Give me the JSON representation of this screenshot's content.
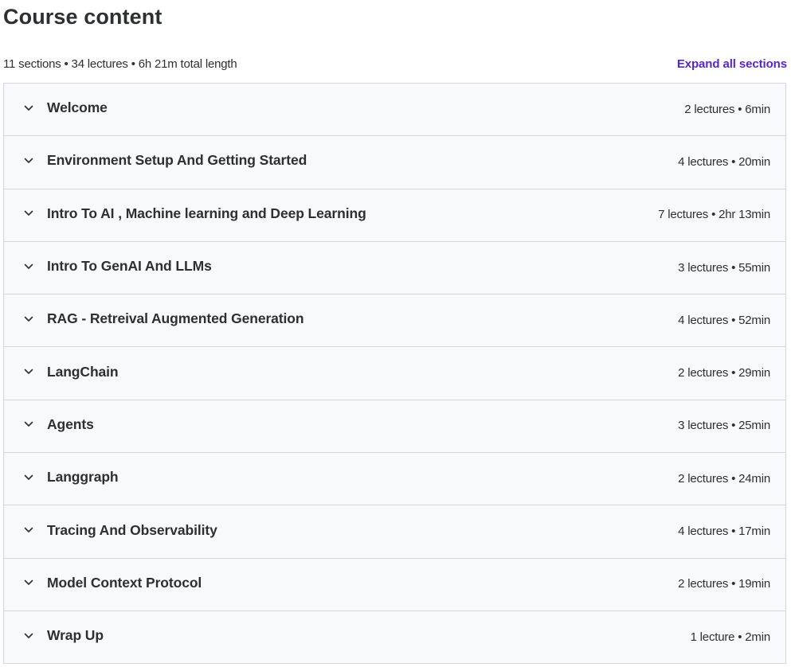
{
  "header": {
    "title": "Course content",
    "summary": "11 sections • 34 lectures • 6h 21m total length",
    "expand_all_label": "Expand all sections",
    "accent_color": "#5624d0"
  },
  "sections": [
    {
      "title": "Welcome",
      "meta": "2 lectures • 6min",
      "icon": "chevron-down-icon"
    },
    {
      "title": "Environment Setup And Getting Started",
      "meta": "4 lectures • 20min",
      "icon": "chevron-down-icon"
    },
    {
      "title": "Intro To AI , Machine learning and Deep Learning",
      "meta": "7 lectures • 2hr 13min",
      "icon": "chevron-down-icon"
    },
    {
      "title": "Intro To GenAI And LLMs",
      "meta": "3 lectures • 55min",
      "icon": "chevron-down-icon"
    },
    {
      "title": "RAG - Retreival Augmented Generation",
      "meta": "4 lectures • 52min",
      "icon": "chevron-down-icon"
    },
    {
      "title": "LangChain",
      "meta": "2 lectures • 29min",
      "icon": "chevron-down-icon"
    },
    {
      "title": "Agents",
      "meta": "3 lectures • 25min",
      "icon": "chevron-down-icon"
    },
    {
      "title": "Langgraph",
      "meta": "2 lectures • 24min",
      "icon": "chevron-down-icon"
    },
    {
      "title": "Tracing And Observability",
      "meta": "4 lectures • 17min",
      "icon": "chevron-down-icon"
    },
    {
      "title": "Model Context Protocol",
      "meta": "2 lectures • 19min",
      "icon": "chevron-down-icon"
    },
    {
      "title": "Wrap Up",
      "meta": "1 lecture • 2min",
      "icon": "chevron-down-icon"
    }
  ]
}
